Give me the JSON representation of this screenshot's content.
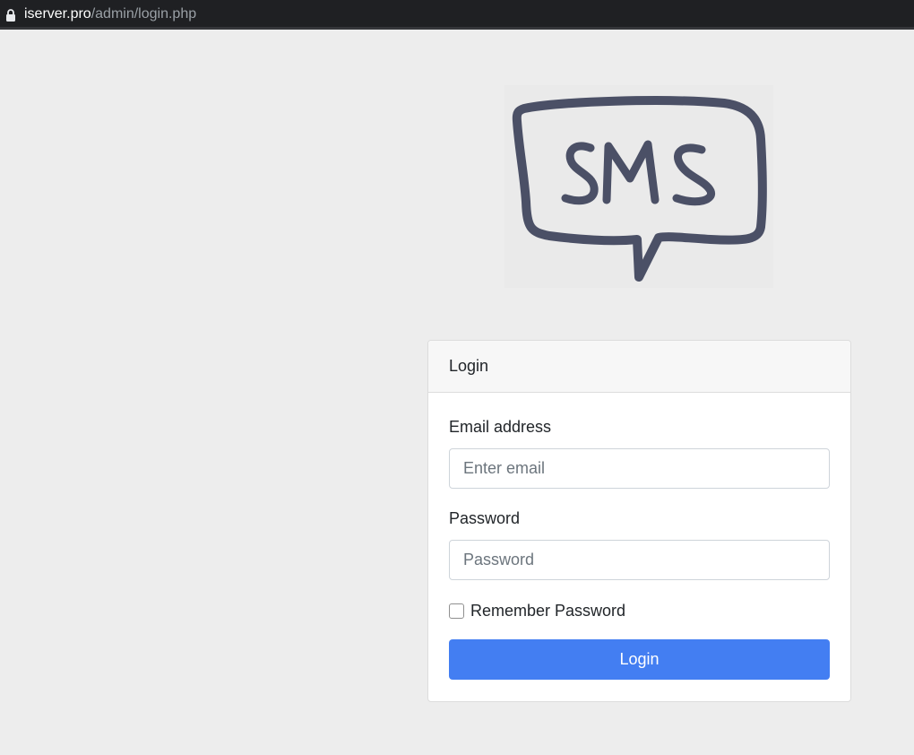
{
  "browser": {
    "url_host": "iserver.pro",
    "url_path": "/admin/login.php",
    "lock_icon": "lock-icon"
  },
  "logo": {
    "text": "SMS",
    "icon": "speech-bubble-logo",
    "stroke_color": "#4b5066"
  },
  "card": {
    "title": "Login",
    "email": {
      "label": "Email address",
      "placeholder": "Enter email",
      "value": ""
    },
    "password": {
      "label": "Password",
      "placeholder": "Password",
      "value": ""
    },
    "remember": {
      "label": "Remember Password",
      "checked": false
    },
    "submit_label": "Login"
  },
  "colors": {
    "primary_button": "#437ef2",
    "page_background": "#ededed",
    "address_bar": "#1f2023"
  }
}
